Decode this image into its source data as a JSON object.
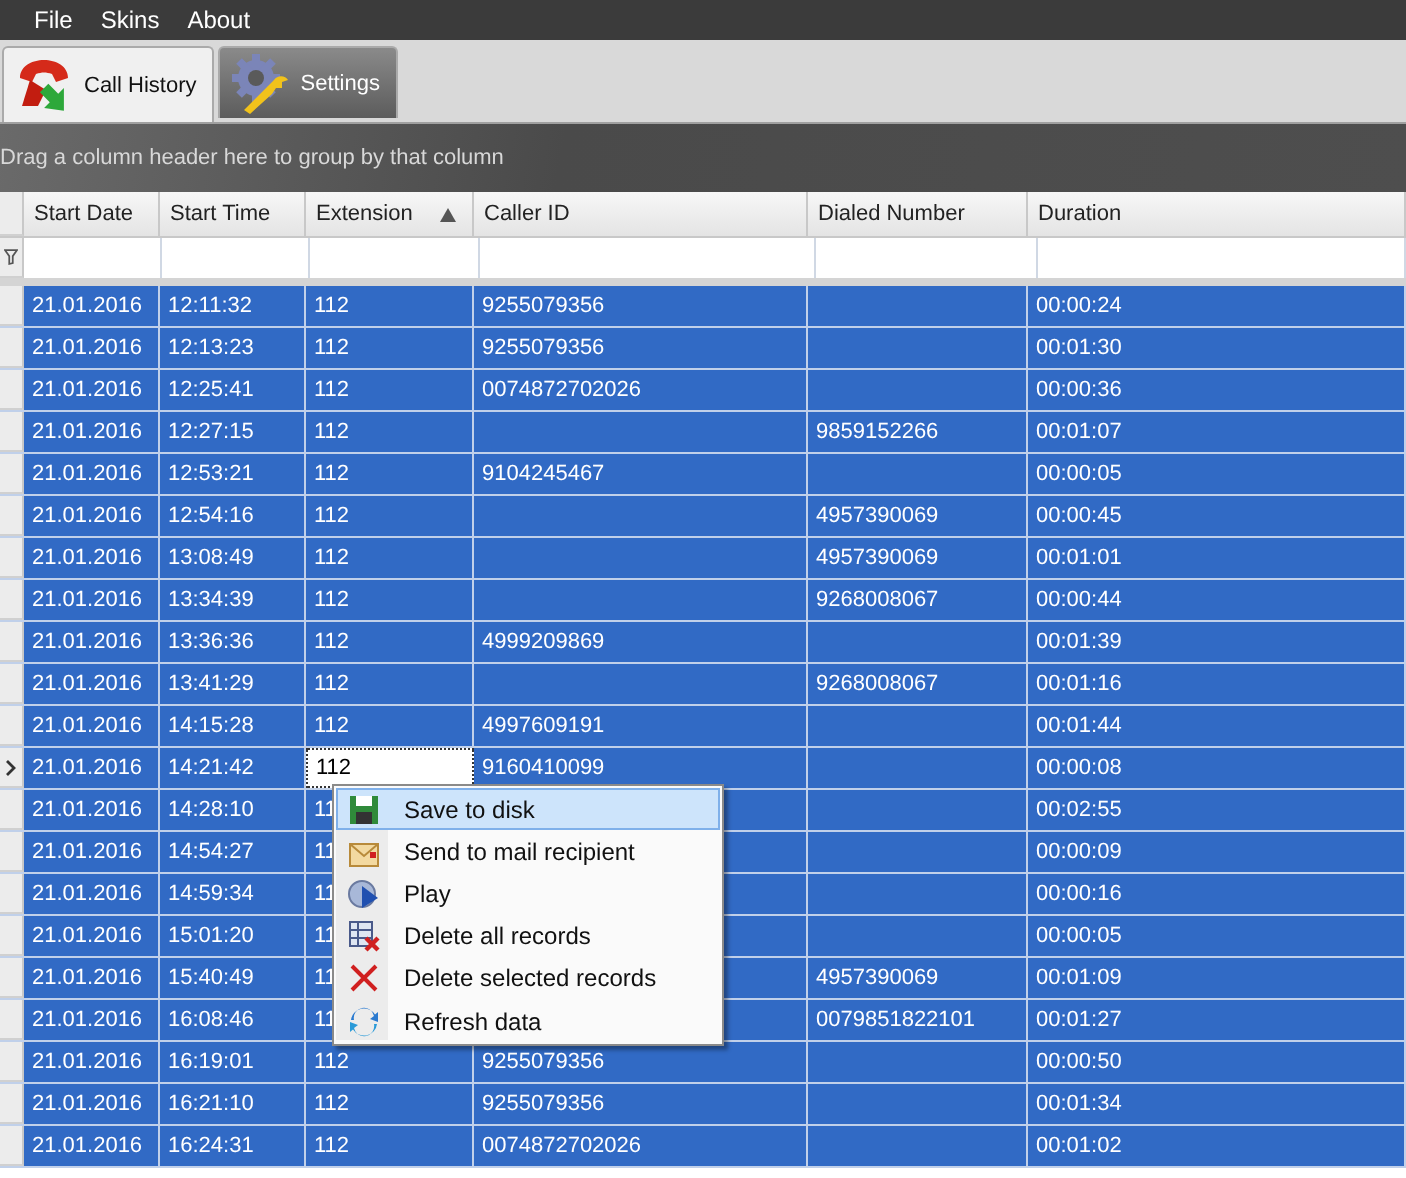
{
  "menu": [
    "File",
    "Skins",
    "About"
  ],
  "tabs": [
    {
      "label": "Call History",
      "selected": true,
      "kind": "history"
    },
    {
      "label": "Settings",
      "selected": false,
      "kind": "settings"
    }
  ],
  "group_panel": "Drag a column header here to group by that column",
  "table": {
    "columns": [
      {
        "label": "Start Date",
        "sorted": false
      },
      {
        "label": "Start Time",
        "sorted": false
      },
      {
        "label": "Extension",
        "sorted": true
      },
      {
        "label": "Caller ID",
        "sorted": false
      },
      {
        "label": "Dialed Number",
        "sorted": false
      },
      {
        "label": "Duration",
        "sorted": false
      }
    ],
    "rows": [
      {
        "cells": [
          "21.01.2016",
          "12:11:32",
          "112",
          "9255079356",
          "",
          "00:00:24"
        ],
        "selected": true,
        "current": false
      },
      {
        "cells": [
          "21.01.2016",
          "12:13:23",
          "112",
          "9255079356",
          "",
          "00:01:30"
        ],
        "selected": true,
        "current": false
      },
      {
        "cells": [
          "21.01.2016",
          "12:25:41",
          "112",
          "0074872702026",
          "",
          "00:00:36"
        ],
        "selected": true,
        "current": false
      },
      {
        "cells": [
          "21.01.2016",
          "12:27:15",
          "112",
          "",
          "9859152266",
          "00:01:07"
        ],
        "selected": true,
        "current": false
      },
      {
        "cells": [
          "21.01.2016",
          "12:53:21",
          "112",
          "9104245467",
          "",
          "00:00:05"
        ],
        "selected": true,
        "current": false
      },
      {
        "cells": [
          "21.01.2016",
          "12:54:16",
          "112",
          "",
          "4957390069",
          "00:00:45"
        ],
        "selected": true,
        "current": false
      },
      {
        "cells": [
          "21.01.2016",
          "13:08:49",
          "112",
          "",
          "4957390069",
          "00:01:01"
        ],
        "selected": true,
        "current": false
      },
      {
        "cells": [
          "21.01.2016",
          "13:34:39",
          "112",
          "",
          "9268008067",
          "00:00:44"
        ],
        "selected": true,
        "current": false
      },
      {
        "cells": [
          "21.01.2016",
          "13:36:36",
          "112",
          "4999209869",
          "",
          "00:01:39"
        ],
        "selected": true,
        "current": false
      },
      {
        "cells": [
          "21.01.2016",
          "13:41:29",
          "112",
          "",
          "9268008067",
          "00:01:16"
        ],
        "selected": true,
        "current": false
      },
      {
        "cells": [
          "21.01.2016",
          "14:15:28",
          "112",
          "4997609191",
          "",
          "00:01:44"
        ],
        "selected": true,
        "current": false
      },
      {
        "cells": [
          "21.01.2016",
          "14:21:42",
          "112",
          "9160410099",
          "",
          "00:00:08"
        ],
        "selected": true,
        "current": true
      },
      {
        "cells": [
          "21.01.2016",
          "14:28:10",
          "11",
          "",
          "",
          "00:02:55"
        ],
        "selected": true,
        "current": false
      },
      {
        "cells": [
          "21.01.2016",
          "14:54:27",
          "11",
          "",
          "",
          "00:00:09"
        ],
        "selected": true,
        "current": false
      },
      {
        "cells": [
          "21.01.2016",
          "14:59:34",
          "11",
          "",
          "",
          "00:00:16"
        ],
        "selected": true,
        "current": false
      },
      {
        "cells": [
          "21.01.2016",
          "15:01:20",
          "11",
          "",
          "",
          "00:00:05"
        ],
        "selected": true,
        "current": false
      },
      {
        "cells": [
          "21.01.2016",
          "15:40:49",
          "11",
          "",
          "4957390069",
          "00:01:09"
        ],
        "selected": true,
        "current": false
      },
      {
        "cells": [
          "21.01.2016",
          "16:08:46",
          "11",
          "",
          "0079851822101",
          "00:01:27"
        ],
        "selected": true,
        "current": false
      },
      {
        "cells": [
          "21.01.2016",
          "16:19:01",
          "112",
          "9255079356",
          "",
          "00:00:50"
        ],
        "selected": true,
        "current": false
      },
      {
        "cells": [
          "21.01.2016",
          "16:21:10",
          "112",
          "9255079356",
          "",
          "00:01:34"
        ],
        "selected": true,
        "current": false
      },
      {
        "cells": [
          "21.01.2016",
          "16:24:31",
          "112",
          "0074872702026",
          "",
          "00:01:02"
        ],
        "selected": true,
        "current": false
      }
    ]
  },
  "context_menu": [
    {
      "label": "Save to disk",
      "kind": "save",
      "selected": true
    },
    {
      "label": "Send to mail recipient",
      "kind": "mail",
      "selected": false
    },
    {
      "label": "Play",
      "kind": "play",
      "selected": false
    },
    {
      "label": "Delete all records",
      "kind": "clear",
      "selected": false
    },
    {
      "label": "Delete selected records",
      "kind": "delete",
      "selected": false
    },
    {
      "label": "Refresh data",
      "kind": "refresh",
      "selected": false
    }
  ]
}
